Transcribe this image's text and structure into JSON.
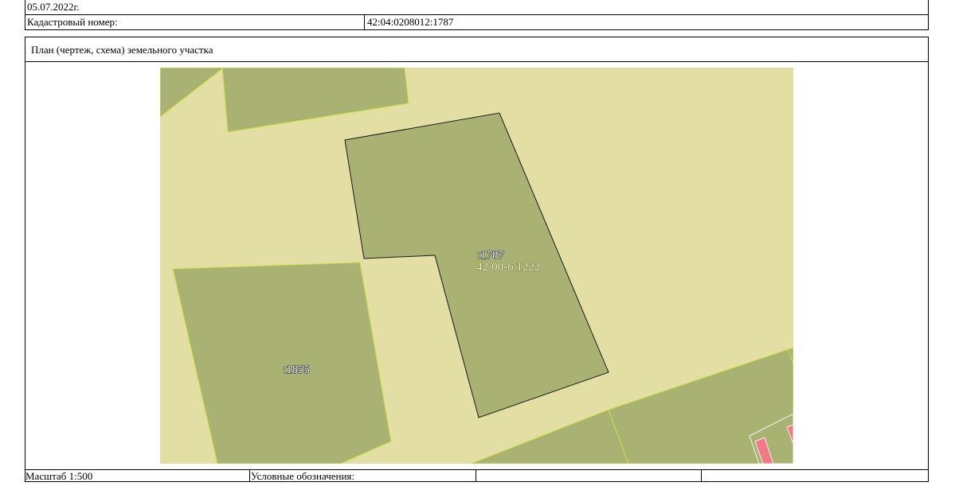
{
  "header": {
    "date": "05.07.2022г.",
    "cadastral_label": "Кадастровый номер:",
    "cadastral_value": "42:04:0208012:1787"
  },
  "plan": {
    "title": "План (чертеж, схема) земельного участка"
  },
  "map": {
    "parcel_main_label": ":1787",
    "parcel_main_zone": "42:00-6.1222",
    "parcel_neighbor_label": ":1855",
    "colors": {
      "background": "#e3dea4",
      "parcel_fill": "#a9b273",
      "parcel_border": "#cde04a",
      "main_border": "#1a1a1a",
      "building_fill": "#f07a85",
      "zone_text": "#f5f0c8"
    }
  },
  "footer": {
    "scale": "Масштаб 1:500",
    "legend_label": "Условные обозначения:",
    "legend_cell_1": "",
    "legend_cell_2": ""
  }
}
